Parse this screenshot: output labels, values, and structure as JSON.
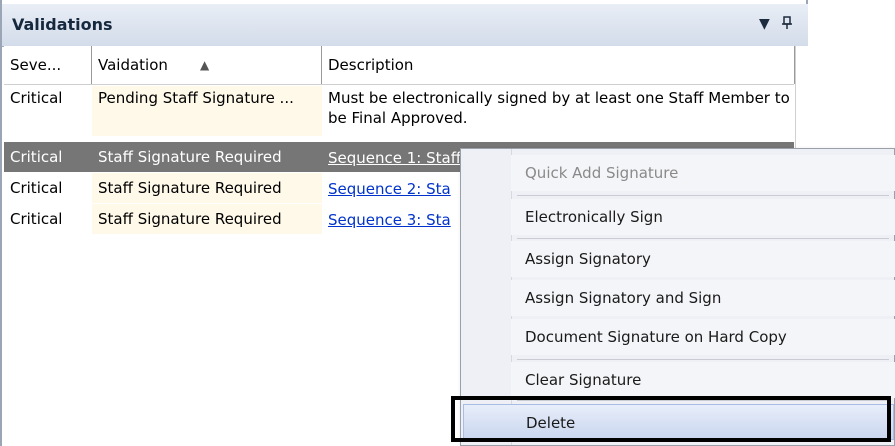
{
  "panel": {
    "title": "Validations",
    "dropdown_glyph": "▾",
    "pin_glyph": "ꟷ"
  },
  "columns": {
    "severity": "Seve...",
    "validation": "Vaidation",
    "description": "Description",
    "sort_indicator": "▲"
  },
  "rows": [
    {
      "severity": "Critical",
      "validation": "Pending Staff Signature ...",
      "description": "Must be electronically signed by at least one Staff Member to be Final Approved."
    },
    {
      "severity": "Critical",
      "validation": "Staff Signature Required",
      "description": "Sequence 1: Staff"
    },
    {
      "severity": "Critical",
      "validation": "Staff Signature Required",
      "description": "Sequence 2: Sta"
    },
    {
      "severity": "Critical",
      "validation": "Staff Signature Required",
      "description": "Sequence 3: Sta"
    }
  ],
  "context_menu": {
    "items": [
      "Quick Add Signature",
      "Electronically Sign",
      "Assign Signatory",
      "Assign Signatory and Sign",
      "Document Signature on Hard Copy",
      "Clear Signature",
      "Delete"
    ],
    "submenu_arrow": "▶"
  },
  "colors": {
    "selected_row": "#767676",
    "link": "#0033cc",
    "validation_cell_bg": "#fff9ea",
    "menu_highlight": "#c9d6ef"
  }
}
